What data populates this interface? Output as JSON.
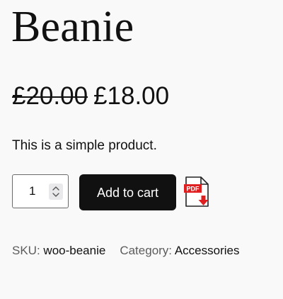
{
  "product": {
    "title": "Beanie",
    "price_regular": "£20.00",
    "price_sale": "£18.00",
    "description": "This is a simple product."
  },
  "cart": {
    "quantity": "1",
    "add_button_label": "Add to cart"
  },
  "pdf": {
    "icon": "pdf-file-download-icon",
    "badge_text": "PDF"
  },
  "meta": {
    "sku_label": "SKU:",
    "sku_value": "woo-beanie",
    "category_label": "Category:",
    "category_value": "Accessories"
  },
  "colors": {
    "background": "#f9f9f9",
    "button": "#111111",
    "pdf_red": "#e02020"
  }
}
